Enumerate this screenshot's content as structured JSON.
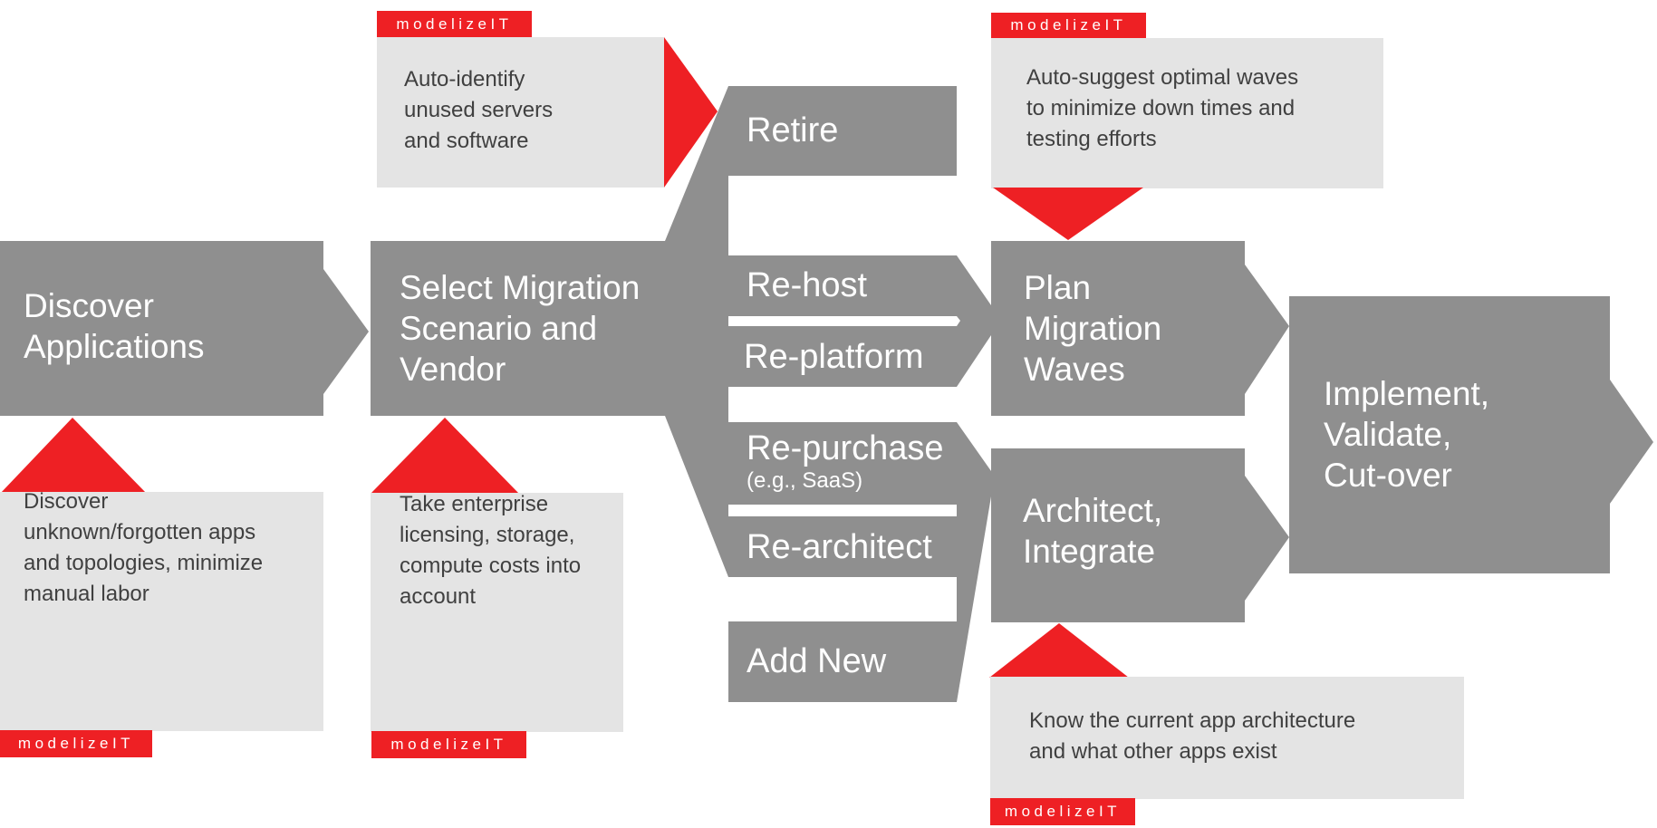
{
  "diagram": {
    "colors": {
      "stage_fill": "#8f8f8f",
      "note_fill": "#e4e4e4",
      "accent": "#ee2024",
      "stage_text": "#ffffff",
      "note_text": "#404040"
    },
    "stages": [
      {
        "id": "discover",
        "label": "Discover\nApplications"
      },
      {
        "id": "select",
        "label": "Select Migration\nScenario and\nVendor"
      },
      {
        "id": "plan",
        "label": "Plan\nMigration\nWaves"
      },
      {
        "id": "architect",
        "label": "Architect,\nIntegrate"
      },
      {
        "id": "implement",
        "label": "Implement,\nValidate,\nCut-over"
      }
    ],
    "branches": [
      {
        "id": "retire",
        "label": "Retire"
      },
      {
        "id": "rehost",
        "label": "Re-host"
      },
      {
        "id": "replatform",
        "label": "Re-platform"
      },
      {
        "id": "repurchase",
        "label": "Re-purchase",
        "sub": "(e.g., SaaS)"
      },
      {
        "id": "rearchitect",
        "label": "Re-architect"
      },
      {
        "id": "addnew",
        "label": "Add New"
      }
    ],
    "callouts": [
      {
        "id": "discover-note",
        "text": "Discover\nunknown/forgotten apps\nand topologies, minimize\nmanual labor",
        "brand": "modelizeIT"
      },
      {
        "id": "select-note",
        "text": "Take enterprise\nlicensing, storage,\ncompute costs into\naccount",
        "brand": "modelizeIT"
      },
      {
        "id": "retire-note",
        "text": "Auto-identify\nunused servers\nand software",
        "brand": "modelizeIT"
      },
      {
        "id": "plan-note",
        "text": "Auto-suggest optimal waves\nto minimize down times and\ntesting efforts",
        "brand": "modelizeIT"
      },
      {
        "id": "architect-note",
        "text": "Know the current app architecture\nand what other apps exist",
        "brand": "modelizeIT"
      }
    ]
  }
}
